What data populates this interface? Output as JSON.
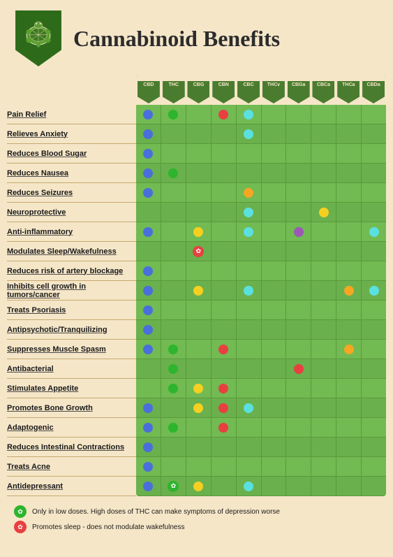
{
  "header": {
    "title": "Cannabinoid Benefits"
  },
  "columns": [
    "CBD",
    "THC",
    "CBG",
    "CBN",
    "CBC",
    "THCv",
    "CBGa",
    "CBCa",
    "THCa",
    "CBDa"
  ],
  "rows": [
    {
      "label": "Pain Relief",
      "dots": [
        {
          "col": 0,
          "color": "#4a6fdb"
        },
        {
          "col": 1,
          "color": "#2db52d"
        },
        {
          "col": 3,
          "color": "#e84040"
        },
        {
          "col": 4,
          "color": "#5be0e0"
        }
      ]
    },
    {
      "label": "Relieves Anxiety",
      "dots": [
        {
          "col": 0,
          "color": "#4a6fdb"
        },
        {
          "col": 4,
          "color": "#5be0e0"
        }
      ]
    },
    {
      "label": "Reduces Blood Sugar",
      "dots": [
        {
          "col": 0,
          "color": "#4a6fdb"
        }
      ]
    },
    {
      "label": "Reduces Nausea",
      "dots": [
        {
          "col": 0,
          "color": "#4a6fdb"
        },
        {
          "col": 1,
          "color": "#2db52d"
        }
      ]
    },
    {
      "label": "Reduces Seizures",
      "dots": [
        {
          "col": 0,
          "color": "#4a6fdb"
        },
        {
          "col": 4,
          "color": "#f5a623"
        }
      ]
    },
    {
      "label": "Neuroprotective",
      "dots": [
        {
          "col": 4,
          "color": "#5be0e0"
        },
        {
          "col": 7,
          "color": "#f5d020"
        }
      ]
    },
    {
      "label": "Anti-inflammatory",
      "dots": [
        {
          "col": 0,
          "color": "#4a6fdb"
        },
        {
          "col": 2,
          "color": "#f5d020"
        },
        {
          "col": 4,
          "color": "#5be0e0"
        },
        {
          "col": 6,
          "color": "#9b59b6"
        },
        {
          "col": 9,
          "color": "#5be0e0"
        }
      ]
    },
    {
      "label": "Modulates Sleep/Wakefulness",
      "dots": [
        {
          "col": 2,
          "color": "#e84040",
          "special": true,
          "symbol": "✿"
        }
      ]
    },
    {
      "label": "Reduces risk of artery blockage",
      "dots": [
        {
          "col": 0,
          "color": "#4a6fdb"
        }
      ]
    },
    {
      "label": "Inhibits cell growth in tumors/cancer",
      "dots": [
        {
          "col": 0,
          "color": "#4a6fdb"
        },
        {
          "col": 2,
          "color": "#f5d020"
        },
        {
          "col": 4,
          "color": "#5be0e0"
        },
        {
          "col": 8,
          "color": "#f5a623"
        },
        {
          "col": 9,
          "color": "#5be0e0"
        }
      ]
    },
    {
      "label": "Treats Psoriasis",
      "dots": [
        {
          "col": 0,
          "color": "#4a6fdb"
        }
      ]
    },
    {
      "label": "Antipsychotic/Tranquilizing",
      "dots": [
        {
          "col": 0,
          "color": "#4a6fdb"
        }
      ]
    },
    {
      "label": "Suppresses Muscle Spasm",
      "dots": [
        {
          "col": 0,
          "color": "#4a6fdb"
        },
        {
          "col": 1,
          "color": "#2db52d"
        },
        {
          "col": 3,
          "color": "#e84040"
        },
        {
          "col": 8,
          "color": "#f5a623"
        }
      ]
    },
    {
      "label": "Antibacterial",
      "dots": [
        {
          "col": 1,
          "color": "#2db52d"
        },
        {
          "col": 6,
          "color": "#e84040"
        }
      ]
    },
    {
      "label": "Stimulates Appetite",
      "dots": [
        {
          "col": 1,
          "color": "#2db52d"
        },
        {
          "col": 2,
          "color": "#f5d020"
        },
        {
          "col": 3,
          "color": "#e84040"
        }
      ]
    },
    {
      "label": "Promotes Bone Growth",
      "dots": [
        {
          "col": 0,
          "color": "#4a6fdb"
        },
        {
          "col": 2,
          "color": "#f5d020"
        },
        {
          "col": 3,
          "color": "#e84040"
        },
        {
          "col": 4,
          "color": "#5be0e0"
        }
      ]
    },
    {
      "label": "Adaptogenic",
      "dots": [
        {
          "col": 0,
          "color": "#4a6fdb"
        },
        {
          "col": 1,
          "color": "#2db52d"
        },
        {
          "col": 3,
          "color": "#e84040"
        }
      ]
    },
    {
      "label": "Reduces Intestinal Contractions",
      "dots": [
        {
          "col": 0,
          "color": "#4a6fdb"
        }
      ]
    },
    {
      "label": "Treats Acne",
      "dots": [
        {
          "col": 0,
          "color": "#4a6fdb"
        }
      ]
    },
    {
      "label": "Antidepressant",
      "dots": [
        {
          "col": 0,
          "color": "#4a6fdb"
        },
        {
          "col": 1,
          "color": "#2db52d",
          "special": true,
          "symbol": "✿"
        },
        {
          "col": 2,
          "color": "#f5d020"
        },
        {
          "col": 4,
          "color": "#5be0e0"
        }
      ]
    }
  ],
  "footer": [
    {
      "symbol": "✿",
      "symbolColor": "#2db52d",
      "text": "Only in low doses. High doses of THC can make symptoms of depression worse"
    },
    {
      "symbol": "✿",
      "symbolColor": "#e84040",
      "text": "Promotes sleep - does not modulate wakefulness"
    }
  ]
}
